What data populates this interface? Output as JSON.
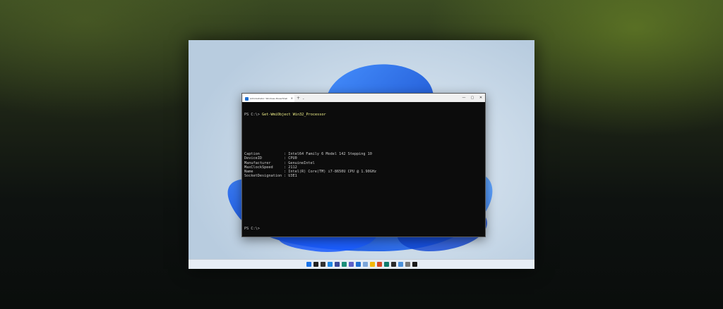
{
  "terminal": {
    "tab_title": "Administrator: Windows PowerShell",
    "new_tab": "+",
    "dropdown": "⌄",
    "controls": {
      "minimize": "—",
      "maximize": "▢",
      "close": "✕"
    },
    "tab_close": "✕",
    "prompt1": "PS C:\\> ",
    "command": "Get-WmiObject Win32_Processor",
    "properties": [
      {
        "name": "Caption",
        "value": ": Intel64 Family 6 Model 142 Stepping 10"
      },
      {
        "name": "DeviceID",
        "value": ": CPU0"
      },
      {
        "name": "Manufacturer",
        "value": ": GenuineIntel"
      },
      {
        "name": "MaxClockSpeed",
        "value": ": 2112"
      },
      {
        "name": "Name",
        "value": ": Intel(R) Core(TM) i7-8650U CPU @ 1.90GHz"
      },
      {
        "name": "SocketDesignation",
        "value": ": U3E1"
      }
    ],
    "prompt2": "PS C:\\>"
  },
  "taskbar": {
    "icons": [
      {
        "name": "start-icon",
        "color": "#1a73e8"
      },
      {
        "name": "search-icon",
        "color": "#222222"
      },
      {
        "name": "task-view-icon",
        "color": "#333333"
      },
      {
        "name": "widgets-icon",
        "color": "#1e88e5"
      },
      {
        "name": "store-icon",
        "color": "#3b4a9c"
      },
      {
        "name": "edge-icon",
        "color": "#1b8f7a"
      },
      {
        "name": "chat-icon",
        "color": "#5b5fc7"
      },
      {
        "name": "vscode-icon",
        "color": "#1f6fd1"
      },
      {
        "name": "notepad-icon",
        "color": "#7aa4d9"
      },
      {
        "name": "file-explorer-icon",
        "color": "#f2b705"
      },
      {
        "name": "powerpoint-icon",
        "color": "#d24726"
      },
      {
        "name": "edge-dev-icon",
        "color": "#0f7b6c"
      },
      {
        "name": "terminal-icon",
        "color": "#2b2b2b"
      },
      {
        "name": "phone-icon",
        "color": "#4a90d9"
      },
      {
        "name": "settings-icon",
        "color": "#777777"
      },
      {
        "name": "terminal-active-icon",
        "color": "#1c1c1c"
      }
    ]
  }
}
